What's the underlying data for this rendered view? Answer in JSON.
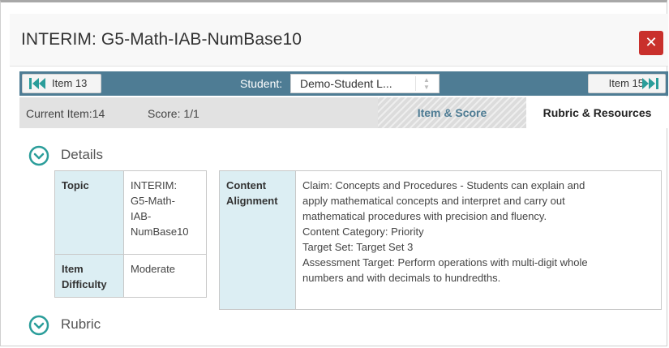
{
  "window": {
    "title": "INTERIM: G5-Math-IAB-NumBase10",
    "close_icon": "close-x-icon",
    "close_color": "#c9302c"
  },
  "nav": {
    "prev_label": "Item 13",
    "next_label": "Item 15",
    "student_label": "Student:",
    "student_value": "Demo-Student L...",
    "bar_color": "#4e7c94"
  },
  "status": {
    "current_item": "Current Item:14",
    "score": "Score: 1/1"
  },
  "tabs": [
    {
      "label": "Item & Score",
      "selected": false
    },
    {
      "label": "Rubric & Resources",
      "selected": true
    }
  ],
  "sections": {
    "details_title": "Details",
    "rubric_title": "Rubric"
  },
  "details": {
    "topic_label": "Topic",
    "topic_value": [
      "INTERIM:",
      "G5-Math-",
      "IAB-",
      "NumBase10"
    ],
    "difficulty_label": [
      "Item",
      "Difficulty"
    ],
    "difficulty_value": "Moderate",
    "alignment_label": [
      "Content",
      "Alignment"
    ],
    "alignment_lines": [
      "Claim: Concepts and Procedures - Students can explain and",
      "apply mathematical concepts and interpret and carry out",
      "mathematical procedures with precision and fluency.",
      "Content Category: Priority",
      "Target Set: Target Set 3",
      "Assessment Target: Perform operations with multi-digit whole",
      "numbers and with decimals to hundredths."
    ]
  },
  "colors": {
    "accent": "#2a9d9a",
    "label_cell": "#dceef3"
  }
}
